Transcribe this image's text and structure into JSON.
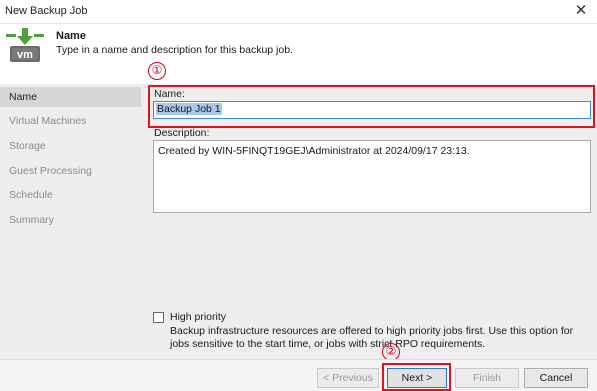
{
  "window": {
    "title": "New Backup Job",
    "close_glyph": "✕"
  },
  "header": {
    "title": "Name",
    "description": "Type in a name and description for this backup job.",
    "logo_icon": "vm-backup-icon",
    "logo_text": "vm"
  },
  "sidebar": {
    "items": [
      {
        "label": "Name",
        "active": true
      },
      {
        "label": "Virtual Machines",
        "active": false
      },
      {
        "label": "Storage",
        "active": false
      },
      {
        "label": "Guest Processing",
        "active": false
      },
      {
        "label": "Schedule",
        "active": false
      },
      {
        "label": "Summary",
        "active": false
      }
    ]
  },
  "annotations": {
    "marker_1": "①",
    "marker_2": "②",
    "highlight_color": "#e1141b"
  },
  "form": {
    "name_label": "Name:",
    "name_value": "Backup Job 1",
    "description_label": "Description:",
    "description_value": "Created by WIN-5FINQT19GEJ\\Administrator at 2024/09/17 23:13.",
    "high_priority_label": "High priority",
    "high_priority_checked": false,
    "high_priority_description": "Backup infrastructure resources are offered to high priority jobs first. Use this option for jobs sensitive to the start time, or jobs with strict RPO requirements."
  },
  "buttons": {
    "previous": {
      "label": "< Previous",
      "enabled": false
    },
    "next": {
      "label": "Next >",
      "enabled": true
    },
    "finish": {
      "label": "Finish",
      "enabled": false
    },
    "cancel": {
      "label": "Cancel",
      "enabled": true
    }
  },
  "colors": {
    "accent": "#3c8bd6",
    "logo_green": "#4aa23b",
    "sidebar_bg": "#eeeeee",
    "active_item_bg": "#d6d6d6"
  }
}
